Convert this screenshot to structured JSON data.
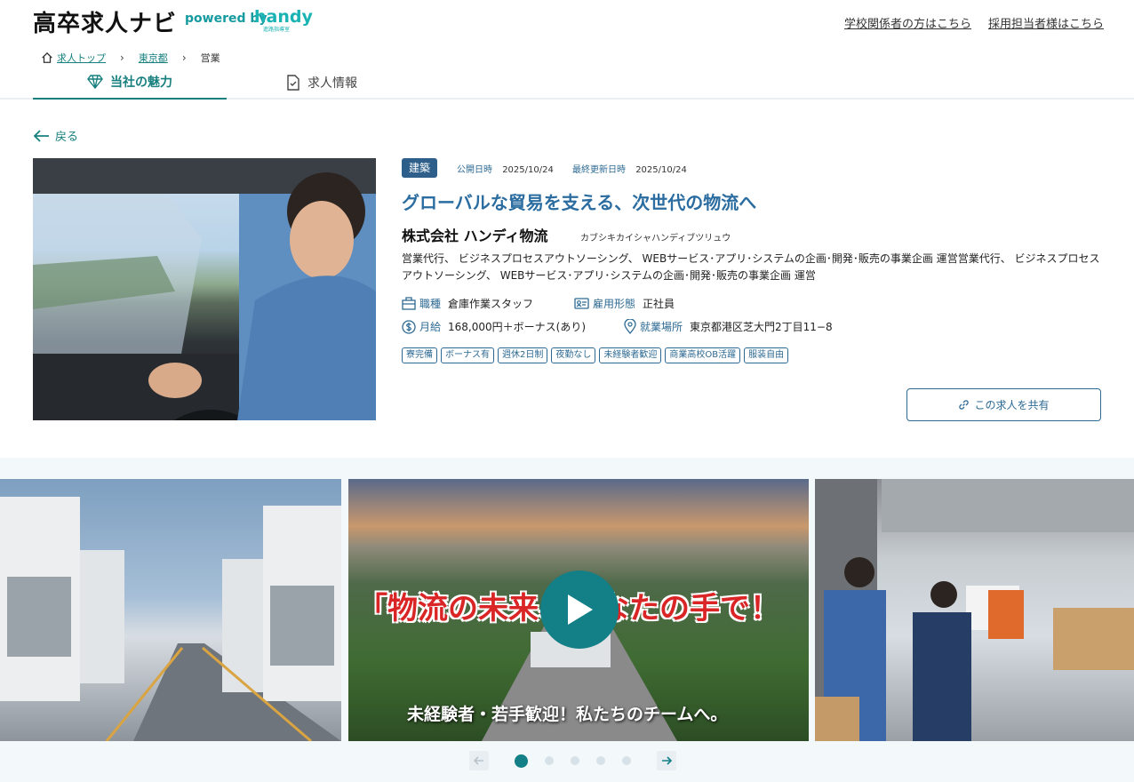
{
  "header": {
    "logo": "高卒求人ナビ",
    "powered_by": "powered by",
    "brand": "handy",
    "brand_sub": "進路指導室",
    "school_link": "学校関係者の方はこちら",
    "recruit_link": "採用担当者様はこちら"
  },
  "breadcrumb": {
    "items": [
      "求人トップ",
      "東京都",
      "営業"
    ]
  },
  "tabs": [
    "当社の魅力",
    "求人情報"
  ],
  "back_label": "戻る",
  "job": {
    "category": "建築",
    "published_label": "公開日時",
    "published_date": "2025/10/24",
    "updated_label": "最終更新日時",
    "updated_date": "2025/10/24",
    "title": "グローバルな貿易を支える、次世代の物流へ",
    "company": "株式会社 ハンディ物流",
    "company_kana": "カブシキカイシャハンディブツリュウ",
    "description": "営業代行、 ビジネスプロセスアウトソーシング、 WEBサービス･アプリ･システムの企画･開発･販売の事業企画 運営営業代行、 ビジネスプロセスアウトソーシング、 WEBサービス･アプリ･システムの企画･開発･販売の事業企画 運営",
    "attributes": {
      "job_type_label": "職種",
      "job_type": "倉庫作業スタッフ",
      "employment_label": "雇用形態",
      "employment": "正社員",
      "salary_label": "月給",
      "salary": "168,000円＋ボーナス(あり)",
      "location_label": "就業場所",
      "location": "東京都港区芝大門2丁目11−8"
    },
    "tags": [
      "寮完備",
      "ボーナス有",
      "週休2日制",
      "夜勤なし",
      "未経験者歓迎",
      "商業高校OB活躍",
      "服装自由"
    ],
    "share_label": "この求人を共有"
  },
  "gallery": {
    "banner_text": "「物流の未来、あなたの手で！",
    "caption_text": "未経験者・若手歓迎！私たちのチームへ。",
    "page_count": 5,
    "active_page": 1
  },
  "colors": {
    "teal": "#17807f",
    "blue": "#2d6a93",
    "title_blue": "#2b6da0"
  }
}
